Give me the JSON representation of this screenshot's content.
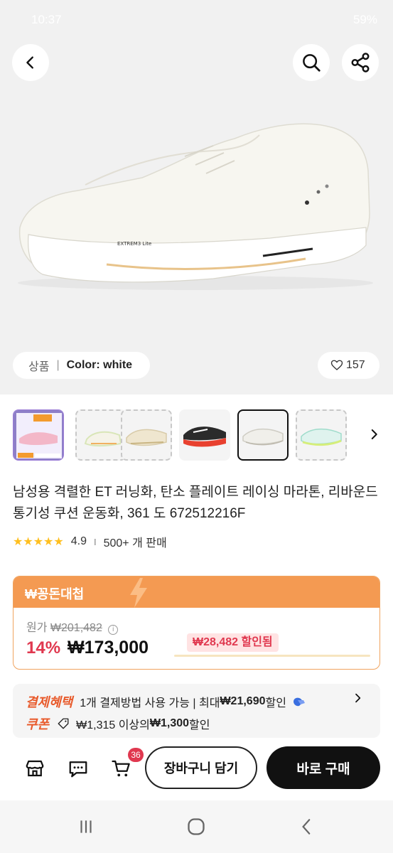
{
  "status_bar": {
    "time": "10:37",
    "battery": "59%"
  },
  "header": {
    "back_icon": "chevron-left-icon",
    "search_icon": "search-icon",
    "share_icon": "share-icon"
  },
  "variant_chip": {
    "label": "상품",
    "separator": "|",
    "value": "Color: white"
  },
  "like": {
    "count": "157",
    "icon": "heart-outline-icon"
  },
  "thumbnails": [
    {
      "color": "pink",
      "style": "promo"
    },
    {
      "color": "white-green",
      "style": "dashed"
    },
    {
      "color": "cream",
      "style": "dashed"
    },
    {
      "color": "red-black",
      "style": "plain"
    },
    {
      "color": "white",
      "style": "selected"
    },
    {
      "color": "mint-lime",
      "style": "dashed"
    }
  ],
  "product": {
    "title": "남성용 격렬한 ET 러닝화, 탄소 플레이트 레이싱 마라톤, 리바운드 통기성 쿠션 운동화, 361 도 672512216F",
    "rating": "4.9",
    "rating_stars": 5,
    "sales": "500+ 개 판매"
  },
  "deal": {
    "badge": "₩꽁돈대첩",
    "original_label": "원가",
    "original_price": "₩201,482",
    "discount": "14%",
    "price": "₩173,000",
    "saved": "₩28,482 할인됨",
    "accent_color": "#f49a52"
  },
  "benefits": {
    "payment_tag": "결제혜택",
    "payment_text_prefix": "1개 결제방법 사용 가능 | 최대 ",
    "payment_amount": "₩21,690",
    "payment_text_suffix": " 할인",
    "coupon_tag": "쿠폰",
    "coupon_text_prefix": "₩1,315 이상의 ",
    "coupon_amount": "₩1,300",
    "coupon_text_suffix": " 할인"
  },
  "bottom_bar": {
    "store_icon": "store-icon",
    "chat_icon": "chat-icon",
    "cart_icon": "cart-icon",
    "cart_count": "36",
    "add_to_cart": "장바구니 담기",
    "buy_now": "바로 구매"
  },
  "nav": {
    "recent_icon": "recent-apps-icon",
    "home_icon": "home-icon",
    "back_icon": "back-icon"
  }
}
